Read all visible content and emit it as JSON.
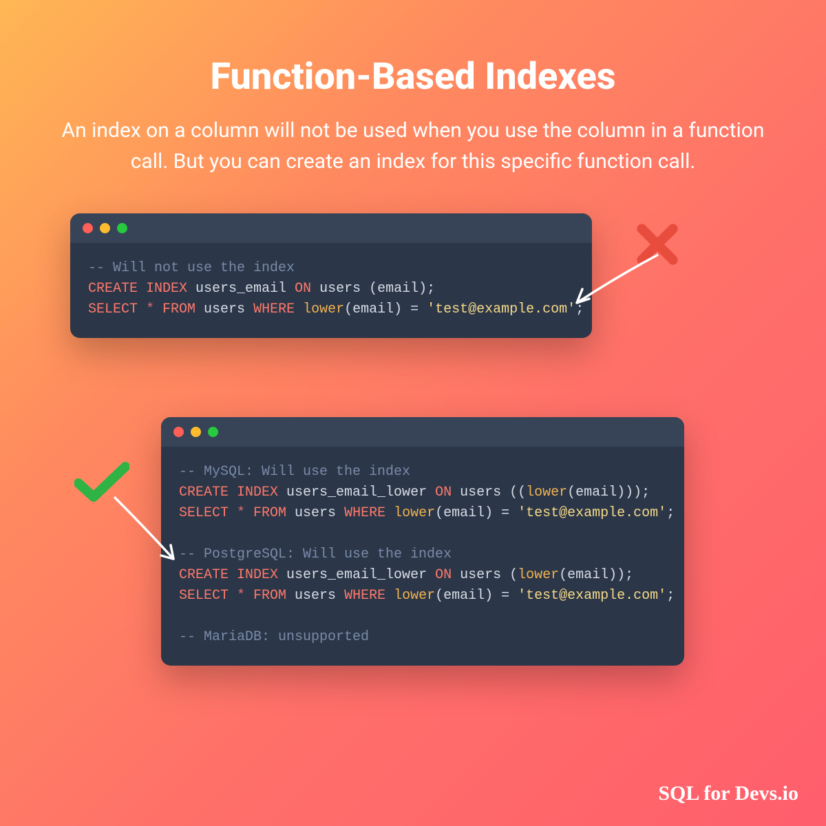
{
  "title": "Function-Based Indexes",
  "subtitle": "An index on a column will not be used when you use the column in a function call. But you can create an index for this specific function call.",
  "footer": "SQL for Devs.io",
  "code1": {
    "comment": "-- Will not use the index",
    "l1_kw1": "CREATE INDEX",
    "l1_name": " users_email ",
    "l1_kw2": "ON",
    "l1_rest": " users (email);",
    "l2_kw1": "SELECT",
    "l2_star": " * ",
    "l2_kw2": "FROM",
    "l2_users": " users ",
    "l2_kw3": "WHERE",
    "l2_sp": " ",
    "l2_func": "lower",
    "l2_args": "(email) = ",
    "l2_str": "'test@example.com'",
    "l2_semi": ";"
  },
  "code2": {
    "c1": "-- MySQL: Will use the index",
    "m_l1_kw1": "CREATE INDEX",
    "m_l1_name": " users_email_lower ",
    "m_l1_kw2": "ON",
    "m_l1_a": " users ((",
    "m_l1_func": "lower",
    "m_l1_b": "(email)));",
    "m_l2_kw1": "SELECT",
    "m_l2_star": " * ",
    "m_l2_kw2": "FROM",
    "m_l2_users": " users ",
    "m_l2_kw3": "WHERE",
    "m_l2_sp": " ",
    "m_l2_func": "lower",
    "m_l2_args": "(email) = ",
    "m_l2_str": "'test@example.com'",
    "m_l2_semi": ";",
    "c2": "-- PostgreSQL: Will use the index",
    "p_l1_kw1": "CREATE INDEX",
    "p_l1_name": " users_email_lower ",
    "p_l1_kw2": "ON",
    "p_l1_a": " users (",
    "p_l1_func": "lower",
    "p_l1_b": "(email));",
    "p_l2_kw1": "SELECT",
    "p_l2_star": " * ",
    "p_l2_kw2": "FROM",
    "p_l2_users": " users ",
    "p_l2_kw3": "WHERE",
    "p_l2_sp": " ",
    "p_l2_func": "lower",
    "p_l2_args": "(email) = ",
    "p_l2_str": "'test@example.com'",
    "p_l2_semi": ";",
    "c3": "-- MariaDB: unsupported"
  }
}
